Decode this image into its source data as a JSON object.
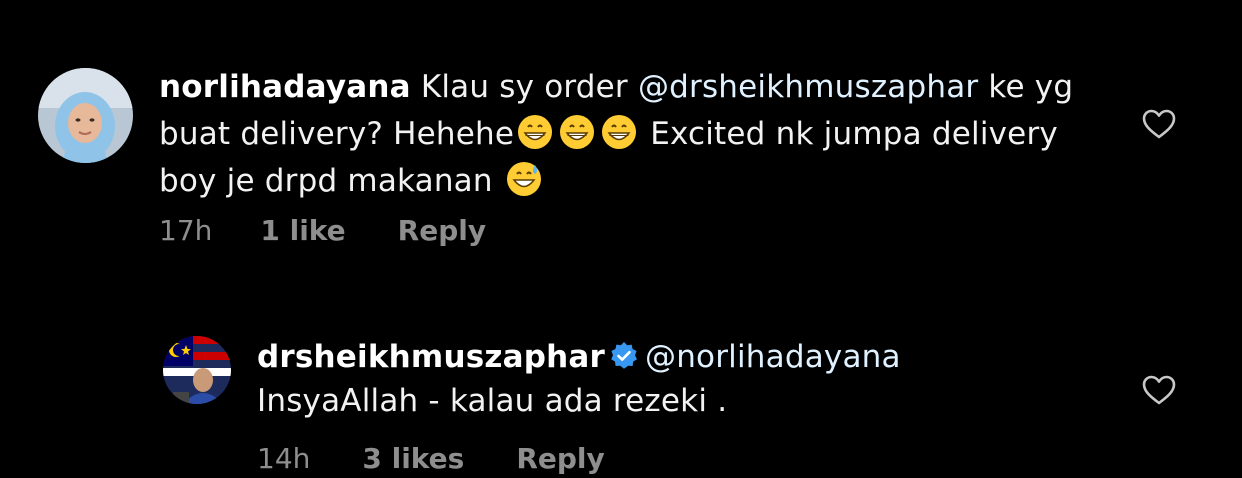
{
  "colors": {
    "background": "#000000",
    "text": "#f2f2f2",
    "meta": "#8e8e8e",
    "verified": "#3897f0"
  },
  "comments": [
    {
      "username": "norlihadayana",
      "text_before_mention": "Klau sy order ",
      "mention": "@drsheikhmuszaphar",
      "text_after_mention": " ke yg buat delivery? Hehehe",
      "emojis_group1": [
        "grinning-face-emoji",
        "grinning-face-emoji",
        "grinning-face-emoji"
      ],
      "text_middle": " Excited nk jumpa delivery boy je drpd makanan ",
      "emojis_group2": [
        "grinning-sweat-emoji"
      ],
      "time": "17h",
      "likes": "1 like",
      "reply_label": "Reply",
      "icons": {
        "avatar": "avatar-photo",
        "like": "heart-outline-icon"
      }
    },
    {
      "username": "drsheikhmuszaphar",
      "verified": true,
      "mention": "@norlihadayana",
      "text": "InsyaAllah - kalau ada rezeki .",
      "time": "14h",
      "likes": "3 likes",
      "reply_label": "Reply",
      "icons": {
        "avatar": "avatar-photo",
        "verified": "verified-badge-icon",
        "like": "heart-outline-icon"
      }
    }
  ]
}
